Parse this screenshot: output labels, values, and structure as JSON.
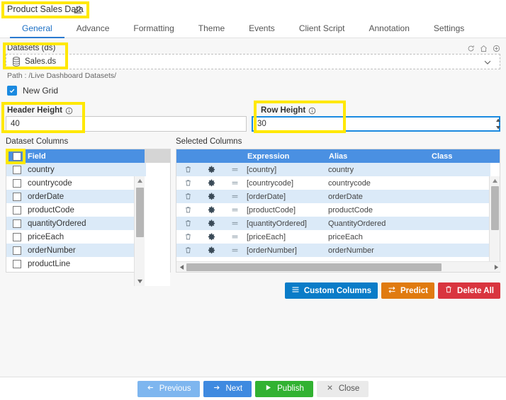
{
  "header": {
    "title": "Product Sales Data",
    "edit_icon": "edit-pencil-icon"
  },
  "tabs": [
    {
      "label": "General",
      "active": true
    },
    {
      "label": "Advance",
      "active": false
    },
    {
      "label": "Formatting",
      "active": false
    },
    {
      "label": "Theme",
      "active": false
    },
    {
      "label": "Events",
      "active": false
    },
    {
      "label": "Client Script",
      "active": false
    },
    {
      "label": "Annotation",
      "active": false
    },
    {
      "label": "Settings",
      "active": false
    }
  ],
  "datasets": {
    "label": "Datasets (ds)",
    "selected": "Sales.ds",
    "dataset_icon": "database-icon",
    "path": "Path : /Live Dashboard Datasets/",
    "tool_icons": [
      "refresh-icon",
      "home-icon",
      "add-icon"
    ],
    "dropdown_icon": "chevron-down-icon"
  },
  "new_grid": {
    "label": "New Grid",
    "checked": true
  },
  "fields": {
    "header_height": {
      "label": "Header Height",
      "value": "40",
      "info_icon": "info-icon"
    },
    "row_height": {
      "label": "Row Height",
      "value": "30",
      "info_icon": "info-icon",
      "focused": true,
      "spinner_icon": "spinner-updown-icon"
    }
  },
  "dataset_columns": {
    "heading": "Dataset Columns",
    "header_label": "Field",
    "header_checkbox_checked": false,
    "rows": [
      {
        "name": "country",
        "checked": false
      },
      {
        "name": "countrycode",
        "checked": false
      },
      {
        "name": "orderDate",
        "checked": false
      },
      {
        "name": "productCode",
        "checked": false
      },
      {
        "name": "quantityOrdered",
        "checked": false
      },
      {
        "name": "priceEach",
        "checked": false
      },
      {
        "name": "orderNumber",
        "checked": false
      },
      {
        "name": "productLine",
        "checked": false
      }
    ]
  },
  "selected_columns": {
    "heading": "Selected Columns",
    "columns": [
      "Expression",
      "Alias",
      "Class"
    ],
    "rows": [
      {
        "expression": "[country]",
        "alias": "country",
        "class": ""
      },
      {
        "expression": "[countrycode]",
        "alias": "countrycode",
        "class": ""
      },
      {
        "expression": "[orderDate]",
        "alias": "orderDate",
        "class": ""
      },
      {
        "expression": "[productCode]",
        "alias": "productCode",
        "class": ""
      },
      {
        "expression": "[quantityOrdered]",
        "alias": "QuantityOrdered",
        "class": ""
      },
      {
        "expression": "[priceEach]",
        "alias": "priceEach",
        "class": ""
      },
      {
        "expression": "[orderNumber]",
        "alias": "orderNumber",
        "class": ""
      }
    ],
    "row_icons": [
      "delete-icon",
      "settings-gear-icon",
      "drag-handle-icon"
    ]
  },
  "actions": [
    {
      "label": "Custom Columns",
      "icon": "hamburger-icon",
      "color": "#0a7cc8"
    },
    {
      "label": "Predict",
      "icon": "exchange-arrows-icon",
      "color": "#e07b10"
    },
    {
      "label": "Delete All",
      "icon": "trash-icon",
      "color": "#d9353f"
    }
  ],
  "footer": [
    {
      "label": "Previous",
      "icon": "arrow-left-icon",
      "color": "#7eb6ef"
    },
    {
      "label": "Next",
      "icon": "arrow-right-icon",
      "color": "#3f8ae0"
    },
    {
      "label": "Publish",
      "icon": "play-icon",
      "color": "#32b232"
    },
    {
      "label": "Close",
      "icon": "close-x-icon",
      "color": "#eaeaea"
    }
  ],
  "annotation_color": "#ffe800"
}
